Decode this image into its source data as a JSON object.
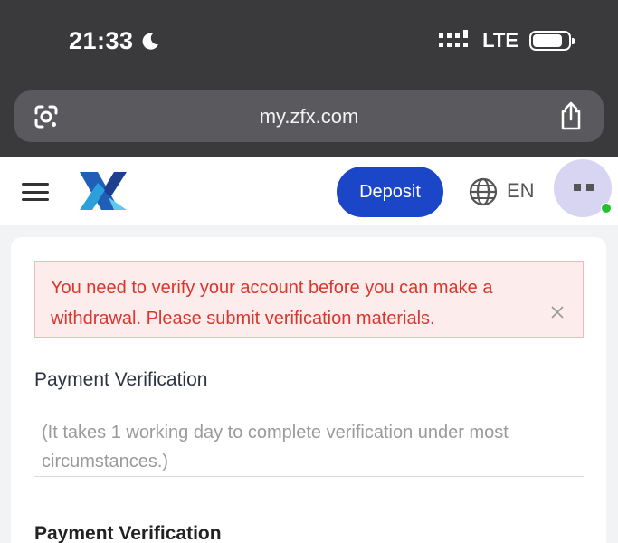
{
  "status_bar": {
    "time": "21:33",
    "network": "LTE",
    "battery_level": 0.85
  },
  "browser": {
    "url": "my.zfx.com"
  },
  "header": {
    "deposit_label": "Deposit",
    "language": "EN"
  },
  "alert": {
    "message": "You need to verify your account before you can make a withdrawal. Please submit verification materials."
  },
  "content": {
    "section_title": "Payment Verification",
    "hint": "(It takes 1 working day to complete verification under most circumstances.)",
    "subsection_title": "Payment Verification"
  },
  "colors": {
    "primary": "#1b46c8",
    "alert_text": "#d9362c",
    "alert_bg": "#fdecec",
    "online": "#22c32a"
  }
}
